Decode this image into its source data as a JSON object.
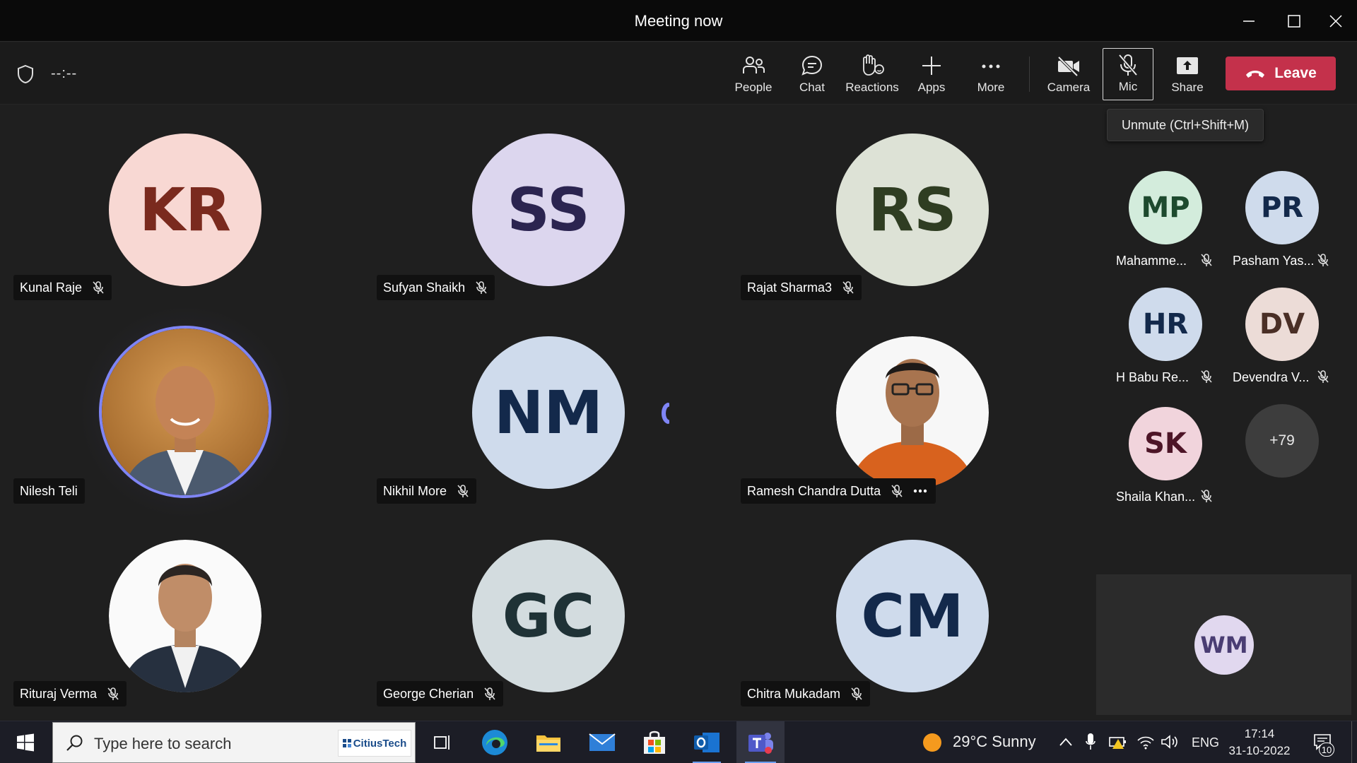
{
  "window": {
    "title": "Meeting now"
  },
  "toolbar": {
    "timer": "--:--",
    "buttons": [
      {
        "label": "People",
        "icon": "people-icon"
      },
      {
        "label": "Chat",
        "icon": "chat-icon"
      },
      {
        "label": "Reactions",
        "icon": "reactions-icon"
      },
      {
        "label": "Apps",
        "icon": "plus-icon"
      },
      {
        "label": "More",
        "icon": "more-icon"
      },
      {
        "label": "Camera",
        "icon": "camera-off-icon"
      },
      {
        "label": "Mic",
        "icon": "mic-off-icon"
      },
      {
        "label": "Share",
        "icon": "share-icon"
      }
    ],
    "leave_label": "Leave",
    "leave_color": "#c4314b"
  },
  "tooltip": "Unmute (Ctrl+Shift+M)",
  "grid": [
    {
      "name": "Kunal Raje",
      "initials": "KR",
      "bg": "#f8d8d3",
      "fg": "#7a2a1e",
      "muted": true
    },
    {
      "name": "Sufyan Shaikh",
      "initials": "SS",
      "bg": "#dcd6ee",
      "fg": "#2b2450",
      "muted": true
    },
    {
      "name": "Rajat Sharma3",
      "initials": "RS",
      "bg": "#dde2d6",
      "fg": "#2f3d22",
      "muted": true
    },
    {
      "name": "Nilesh Teli",
      "initials": "",
      "photo": true,
      "speaking": true,
      "muted": false
    },
    {
      "name": "Nikhil More",
      "initials": "NM",
      "bg": "#cfdbec",
      "fg": "#13294b",
      "muted": true
    },
    {
      "name": "Ramesh Chandra Dutta",
      "initials": "",
      "photo": true,
      "muted": true,
      "more": true
    },
    {
      "name": "Rituraj Verma",
      "initials": "",
      "photo": true,
      "muted": true
    },
    {
      "name": "George Cherian",
      "initials": "GC",
      "bg": "#d3dcdf",
      "fg": "#1f3236",
      "muted": true
    },
    {
      "name": "Chitra Mukadam",
      "initials": "CM",
      "bg": "#cfdbec",
      "fg": "#13294b",
      "muted": true
    }
  ],
  "side": [
    {
      "name": "Mahamme...",
      "initials": "MP",
      "bg": "#d3ecdc",
      "fg": "#1d4a2e"
    },
    {
      "name": "Pasham Yas...",
      "initials": "PR",
      "bg": "#cfdbec",
      "fg": "#13294b"
    },
    {
      "name": "H Babu Re...",
      "initials": "HR",
      "bg": "#cfdbec",
      "fg": "#13294b"
    },
    {
      "name": "Devendra V...",
      "initials": "DV",
      "bg": "#ecdcd7",
      "fg": "#4a2f26"
    },
    {
      "name": "Shaila Khan...",
      "initials": "SK",
      "bg": "#f1d4dc",
      "fg": "#4d1527"
    }
  ],
  "overflow_count": "+79",
  "self_view": {
    "initials": "WM"
  },
  "taskbar": {
    "search_placeholder": "Type here to search",
    "search_brand": "CitiusTech",
    "weather": "29°C  Sunny",
    "language": "ENG",
    "time": "17:14",
    "date": "31-10-2022",
    "notification_count": "10"
  }
}
